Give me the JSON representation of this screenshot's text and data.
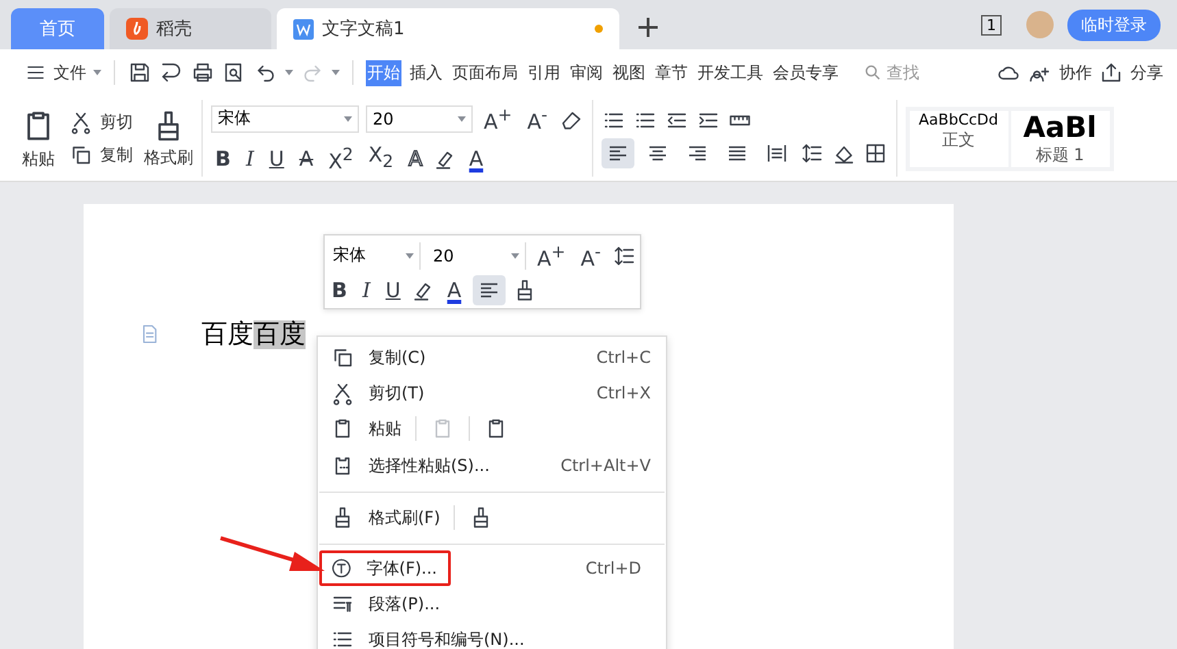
{
  "tabs": [
    {
      "label": "首页",
      "kind": "home",
      "selected": false
    },
    {
      "label": "稻壳",
      "kind": "app",
      "selected": false
    },
    {
      "label": "文字文稿1",
      "kind": "doc",
      "selected": true,
      "unsaved": true
    }
  ],
  "account": {
    "page_count": "1",
    "login": "临时登录"
  },
  "menu_bar": {
    "file": "文件",
    "ribbon_tabs": [
      {
        "label": "开始",
        "selected": true
      },
      {
        "label": "插入",
        "selected": false
      },
      {
        "label": "页面布局",
        "selected": false
      },
      {
        "label": "引用",
        "selected": false
      },
      {
        "label": "审阅",
        "selected": false
      },
      {
        "label": "视图",
        "selected": false
      },
      {
        "label": "章节",
        "selected": false
      },
      {
        "label": "开发工具",
        "selected": false
      },
      {
        "label": "会员专享",
        "selected": false
      }
    ],
    "search": "查找",
    "actions": [
      {
        "label": "协作",
        "kind": "collab"
      },
      {
        "label": "分享",
        "kind": "share"
      }
    ]
  },
  "ribbon": {
    "paste": "粘贴",
    "cut": "剪切",
    "copy": "复制",
    "format_painter": "格式刷",
    "font": "宋体",
    "size": "20",
    "size_buttons": [
      "A$^{+}$",
      "A$^{-}$"
    ],
    "format_buttons": [
      {
        "label": "B",
        "kind": "bold"
      },
      {
        "label": "I",
        "kind": "italic"
      },
      {
        "label": "U",
        "kind": "underline"
      },
      {
        "label": "A",
        "kind": "strike"
      },
      {
        "label": "X$^{2}$",
        "kind": "plain"
      },
      {
        "label": "X$_{2}$",
        "kind": "plain"
      },
      {
        "label": "A",
        "kind": "outline"
      },
      {
        "label": "A",
        "kind": "color"
      }
    ],
    "align": [
      {
        "kind": "left",
        "selected": true
      },
      {
        "kind": "center",
        "selected": false
      },
      {
        "kind": "right",
        "selected": false
      },
      {
        "kind": "justify",
        "selected": false
      },
      {
        "kind": "distributed",
        "selected": false
      }
    ],
    "styles": [
      {
        "preview": "AaBbCcDd",
        "name": "正文",
        "kind": "normal"
      },
      {
        "preview": "AaBl",
        "name": "标题 1",
        "kind": "heading"
      }
    ]
  },
  "document": {
    "before": "百度",
    "selected_text": "百度"
  },
  "mini_toolbar": {
    "font": "宋体",
    "size": "20",
    "size_buttons": [
      "A$^{+}$",
      "A$^{-}$"
    ],
    "format_buttons": [
      {
        "label": "B",
        "kind": "bold"
      },
      {
        "label": "I",
        "kind": "italic"
      },
      {
        "label": "U",
        "kind": "underline"
      }
    ],
    "color_label": "A",
    "align_selected": true
  },
  "context_menu": [
    {
      "label": "复制(C)",
      "shortcut": "Ctrl+C",
      "kind": "copy",
      "separator_after": false,
      "highlighted": false
    },
    {
      "label": "剪切(T)",
      "shortcut": "Ctrl+X",
      "kind": "cut",
      "separator_after": false,
      "highlighted": false
    },
    {
      "label": "粘贴",
      "kind": "paste",
      "separator_after": false,
      "highlighted": false
    },
    {
      "label": "选择性粘贴(S)...",
      "shortcut": "Ctrl+Alt+V",
      "kind": "paste-special",
      "separator_after": true,
      "highlighted": false
    },
    {
      "label": "格式刷(F)",
      "kind": "brush",
      "separator_after": true,
      "highlighted": false
    },
    {
      "label": "字体(F)...",
      "shortcut": "Ctrl+D",
      "kind": "font",
      "separator_after": false,
      "highlighted": true
    },
    {
      "label": "段落(P)...",
      "kind": "paragraph",
      "separator_after": false,
      "highlighted": false
    },
    {
      "label": "项目符号和编号(N)...",
      "kind": "list",
      "separator_after": false,
      "highlighted": false
    }
  ]
}
